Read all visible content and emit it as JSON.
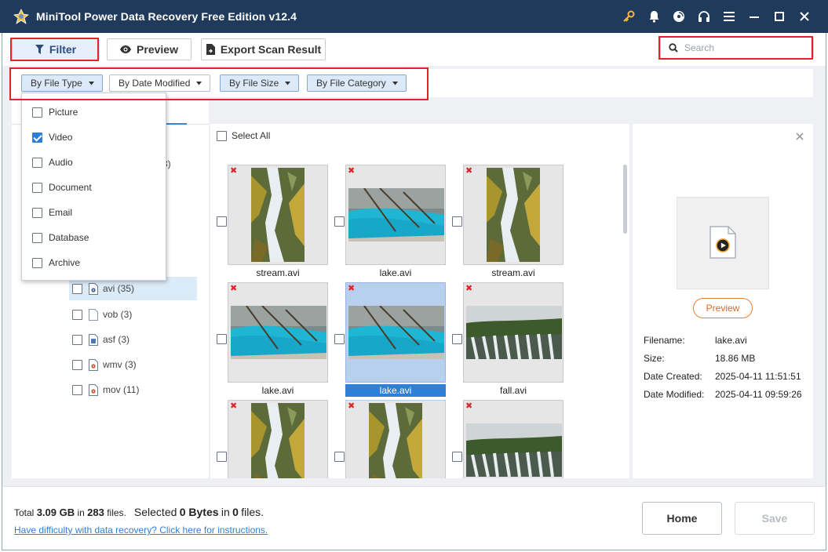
{
  "window": {
    "title": "MiniTool Power Data Recovery Free Edition v12.4"
  },
  "toolbar": {
    "filter_label": "Filter",
    "preview_label": "Preview",
    "export_label": "Export Scan Result",
    "search_placeholder": "Search"
  },
  "filter_chips": [
    {
      "label": "By File Type",
      "active": true
    },
    {
      "label": "By Date Modified",
      "active": false
    },
    {
      "label": "By File Size",
      "active": true
    },
    {
      "label": "By File Category",
      "active": true
    }
  ],
  "file_type_dropdown": [
    {
      "label": "Picture",
      "checked": false
    },
    {
      "label": "Video",
      "checked": true
    },
    {
      "label": "Audio",
      "checked": false
    },
    {
      "label": "Document",
      "checked": false
    },
    {
      "label": "Email",
      "checked": false
    },
    {
      "label": "Database",
      "checked": false
    },
    {
      "label": "Archive",
      "checked": false
    }
  ],
  "tree": {
    "partial_count": "3)",
    "items": [
      {
        "label": "avi (35)",
        "selected": true
      },
      {
        "label": "vob (3)",
        "selected": false
      },
      {
        "label": "asf (3)",
        "selected": false
      },
      {
        "label": "wmv (3)",
        "selected": false
      },
      {
        "label": "mov (11)",
        "selected": false
      }
    ]
  },
  "grid": {
    "select_all_label": "Select All",
    "files": [
      {
        "name": "stream.avi",
        "kind": "stream"
      },
      {
        "name": "lake.avi",
        "kind": "lake"
      },
      {
        "name": "stream.avi",
        "kind": "stream"
      },
      {
        "name": "lake.avi",
        "kind": "lake"
      },
      {
        "name": "lake.avi",
        "kind": "lake",
        "selected": true
      },
      {
        "name": "fall.avi",
        "kind": "fall"
      },
      {
        "name": "",
        "kind": "stream"
      },
      {
        "name": "",
        "kind": "stream"
      },
      {
        "name": "",
        "kind": "fall"
      }
    ]
  },
  "details": {
    "preview_label": "Preview",
    "rows": [
      {
        "key": "Filename:",
        "value": "lake.avi"
      },
      {
        "key": "Size:",
        "value": "18.86 MB"
      },
      {
        "key": "Date Created:",
        "value": "2025-04-11 11:51:51"
      },
      {
        "key": "Date Modified:",
        "value": "2025-04-11 09:59:26"
      }
    ]
  },
  "footer": {
    "total_prefix": "Total",
    "total_size": "3.09 GB",
    "in_word": "in",
    "total_files": "283",
    "files_word": "files.",
    "selected_prefix": "Selected",
    "selected_size": "0 Bytes",
    "selected_in": "in",
    "selected_files": "0",
    "selected_suffix": "files.",
    "help_link": "Have difficulty with data recovery? Click here for instructions.",
    "home_label": "Home",
    "save_label": "Save"
  },
  "colors": {
    "titlebar": "#203a5c",
    "accent_blue": "#2f7fd6",
    "highlight_red": "#e0242a",
    "preview_orange": "#e5823a"
  }
}
